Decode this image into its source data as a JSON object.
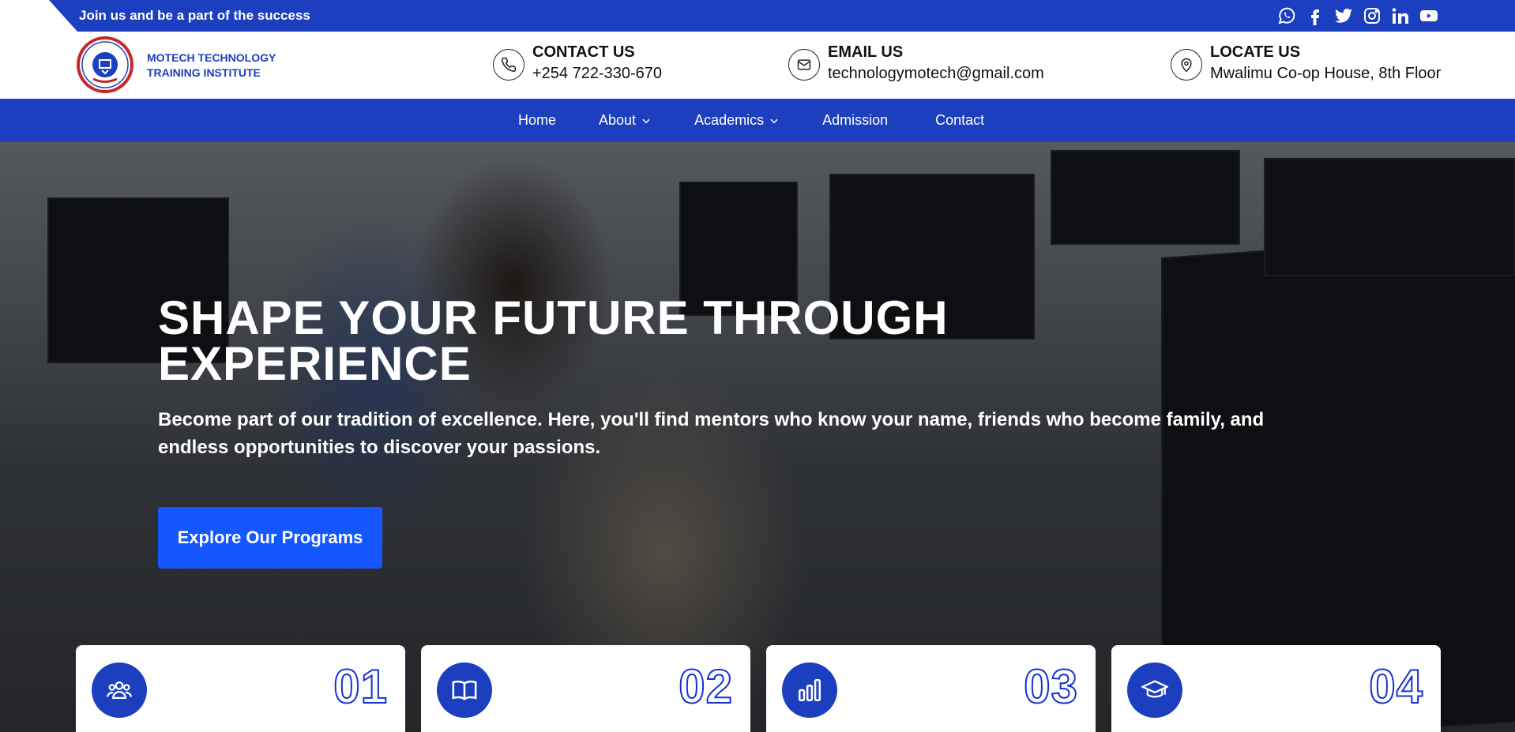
{
  "topbar": {
    "announcement": "Join us and be a part of the success",
    "socials": [
      "whatsapp-icon",
      "facebook-icon",
      "twitter-icon",
      "instagram-icon",
      "linkedin-icon",
      "youtube-icon"
    ]
  },
  "brand": {
    "name_line1": "MOTECH TECHNOLOGY",
    "name_line2": "TRAINING INSTITUTE"
  },
  "contact": {
    "phone_title": "CONTACT US",
    "phone_value": "+254 722-330-670",
    "email_title": "EMAIL US",
    "email_value": "technologymotech@gmail.com",
    "location_title": "LOCATE US",
    "location_value": "Mwalimu Co-op House, 8th Floor"
  },
  "nav": {
    "items": [
      {
        "label": "Home",
        "dropdown": false
      },
      {
        "label": "About",
        "dropdown": true
      },
      {
        "label": "Academics",
        "dropdown": true
      },
      {
        "label": "Admission",
        "dropdown": false
      },
      {
        "label": "Contact",
        "dropdown": false
      }
    ]
  },
  "hero": {
    "title_line1": "SHAPE YOUR FUTURE THROUGH",
    "title_line2": "EXPERIENCE",
    "subtitle": "Become part of our tradition of excellence. Here, you'll find mentors who know your name, friends who become family, and endless opportunities to discover your passions.",
    "button_label": "Explore Our Programs"
  },
  "cards": [
    {
      "number": "01",
      "icon": "users-icon"
    },
    {
      "number": "02",
      "icon": "book-icon"
    },
    {
      "number": "03",
      "icon": "bar-chart-icon"
    },
    {
      "number": "04",
      "icon": "graduation-cap-icon"
    }
  ],
  "colors": {
    "primary": "#1c3fbf",
    "button": "#1557ff",
    "card_number_stroke": "#1431d8"
  }
}
